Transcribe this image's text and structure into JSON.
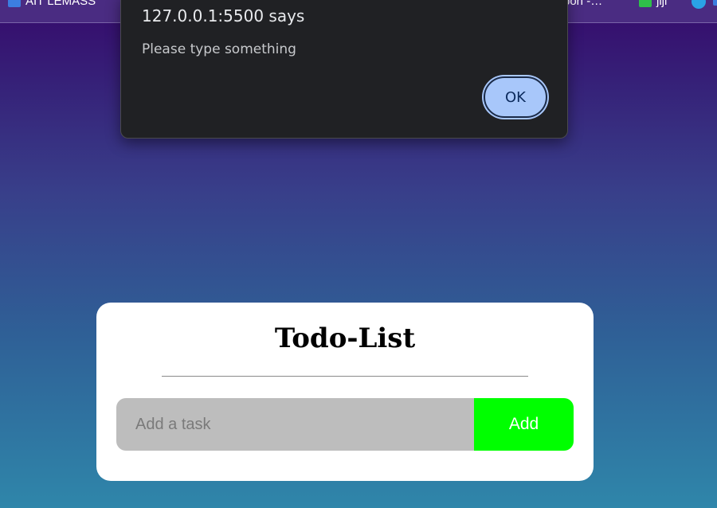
{
  "bookmarks": [
    {
      "label": "AIT LEMASS",
      "icon": "lemass-logo-icon"
    },
    {
      "label": "bon -…",
      "icon": "none"
    },
    {
      "label": "jiji",
      "icon": "jiji-logo-icon"
    },
    {
      "label": "",
      "icon": "telegram-icon"
    },
    {
      "label": "",
      "icon": "partial-bookmark-icon"
    }
  ],
  "dialog": {
    "title": "127.0.0.1:5500 says",
    "message": "Please type something",
    "ok_label": "OK"
  },
  "todo": {
    "title": "Todo-List",
    "input_value": "",
    "input_placeholder": "Add a task",
    "add_label": "Add"
  },
  "colors": {
    "background_top": "#350a6b",
    "background_bottom": "#2f86aa",
    "add_button": "#00ff00",
    "input_bg": "#bdbdbd",
    "dialog_bg": "#202124",
    "ok_button": "#a8c7fa"
  }
}
